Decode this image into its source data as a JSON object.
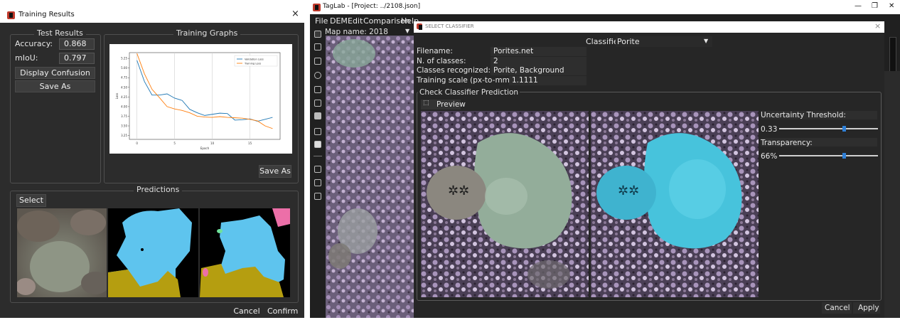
{
  "training_results": {
    "title": "Training Results",
    "close_glyph": "×",
    "test_results": {
      "title": "Test Results",
      "accuracy_label": "Accuracy:",
      "accuracy_value": "0.868",
      "miou_label": "mIoU:",
      "miou_value": "0.797",
      "confusion_button": "Display Confusion Matrix",
      "save_as_button": "Save As"
    },
    "training_graphs": {
      "title": "Training Graphs",
      "save_as_button": "Save As"
    },
    "predictions": {
      "title": "Predictions",
      "select_button": "Select"
    },
    "cancel_button": "Cancel",
    "confirm_button": "Confirm"
  },
  "chart_data": {
    "type": "line",
    "x": [
      0,
      1,
      2,
      3,
      4,
      5,
      6,
      7,
      8,
      9,
      10,
      11,
      12,
      13,
      14,
      15,
      16,
      17,
      18
    ],
    "series": [
      {
        "name": "Validation Loss",
        "color": "#1f77b4",
        "values": [
          5.2,
          4.65,
          4.3,
          4.3,
          4.33,
          4.22,
          4.16,
          3.93,
          3.84,
          3.77,
          3.8,
          3.83,
          3.82,
          3.65,
          3.66,
          3.68,
          3.62,
          3.67,
          3.72
        ]
      },
      {
        "name": "Training Loss",
        "color": "#ff7f0e",
        "values": [
          5.38,
          4.85,
          4.45,
          4.23,
          4.0,
          3.94,
          3.9,
          3.84,
          3.75,
          3.73,
          3.72,
          3.74,
          3.72,
          3.71,
          3.7,
          3.67,
          3.63,
          3.5,
          3.43
        ]
      }
    ],
    "xticks": [
      "0",
      "5",
      "10",
      "15"
    ],
    "yticks": [
      "3.25",
      "3.50",
      "3.75",
      "4.00",
      "4.25",
      "4.50",
      "4.75",
      "5.00",
      "5.25"
    ],
    "xlabel": "Epoch",
    "ylabel": "Loss",
    "xlim": [
      -1,
      19
    ],
    "ylim": [
      3.15,
      5.4
    ],
    "grid": "vertical",
    "legend": "top-right"
  },
  "taglab": {
    "title": "TagLab - [Project: ../2108.json]",
    "menu": [
      "File",
      "DEM",
      "Edit",
      "Comparison",
      "Help"
    ],
    "map_name": "Map name: 2018",
    "window_controls": [
      "—",
      "❐",
      "✕"
    ]
  },
  "select_classifier": {
    "title": "SELECT CLASSIFIER",
    "close_glyph": "×",
    "classifier_label": "Classifier:",
    "classifier_value": "Porite",
    "filename_label": "Filename:",
    "filename_value": "Porites.net",
    "nclasses_label": "N. of classes:",
    "nclasses_value": "2",
    "classes_label": "Classes recognized:",
    "classes_value": "Porite, Background",
    "scale_label": "Training scale (px-to-mm):",
    "scale_value": "1.1111",
    "prediction_group_title": "Check Classifier Prediction",
    "preview_button": "Preview",
    "uncertainty_label": "Uncertainty Threshold:",
    "uncertainty_value": "0.33",
    "uncertainty_fraction": 0.66,
    "transparency_label": "Transparency:",
    "transparency_value": "66%",
    "transparency_fraction": 0.66,
    "cancel_button": "Cancel",
    "apply_button": "Apply"
  }
}
